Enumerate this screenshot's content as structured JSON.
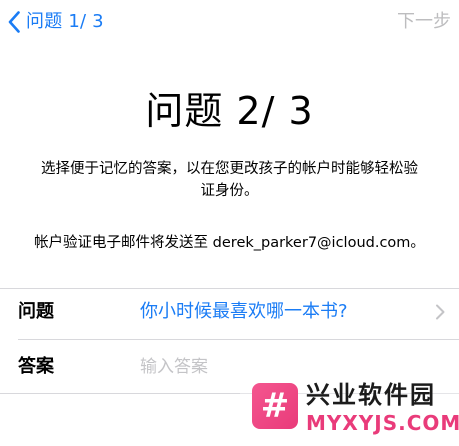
{
  "nav": {
    "back_label": "问题 1/ 3",
    "next_label": "下一步"
  },
  "header": {
    "title": "问题 2/ 3"
  },
  "instructions": {
    "line1": "选择便于记忆的答案，以在您更改孩子的帐户时能够轻松验",
    "line2": "证身份。",
    "email_note": "帐户验证电子邮件将发送至 derek_parker7@icloud.com。"
  },
  "form": {
    "question_label": "问题",
    "question_value": "你小时候最喜欢哪一本书?",
    "answer_label": "答案",
    "answer_placeholder": "输入答案",
    "answer_value": ""
  },
  "watermark": {
    "logo_glyph": "#",
    "title": "兴业软件园",
    "domain": "MYXYJS.COM"
  },
  "colors": {
    "accent": "#1a7cf5",
    "disabled": "#bdbdbf",
    "placeholder": "#c4c4c7",
    "divider": "#d8d8dc",
    "watermark_pink": "#e93b7a"
  },
  "icons": {
    "back": "chevron-left-icon",
    "row_disclosure": "chevron-right-icon"
  }
}
